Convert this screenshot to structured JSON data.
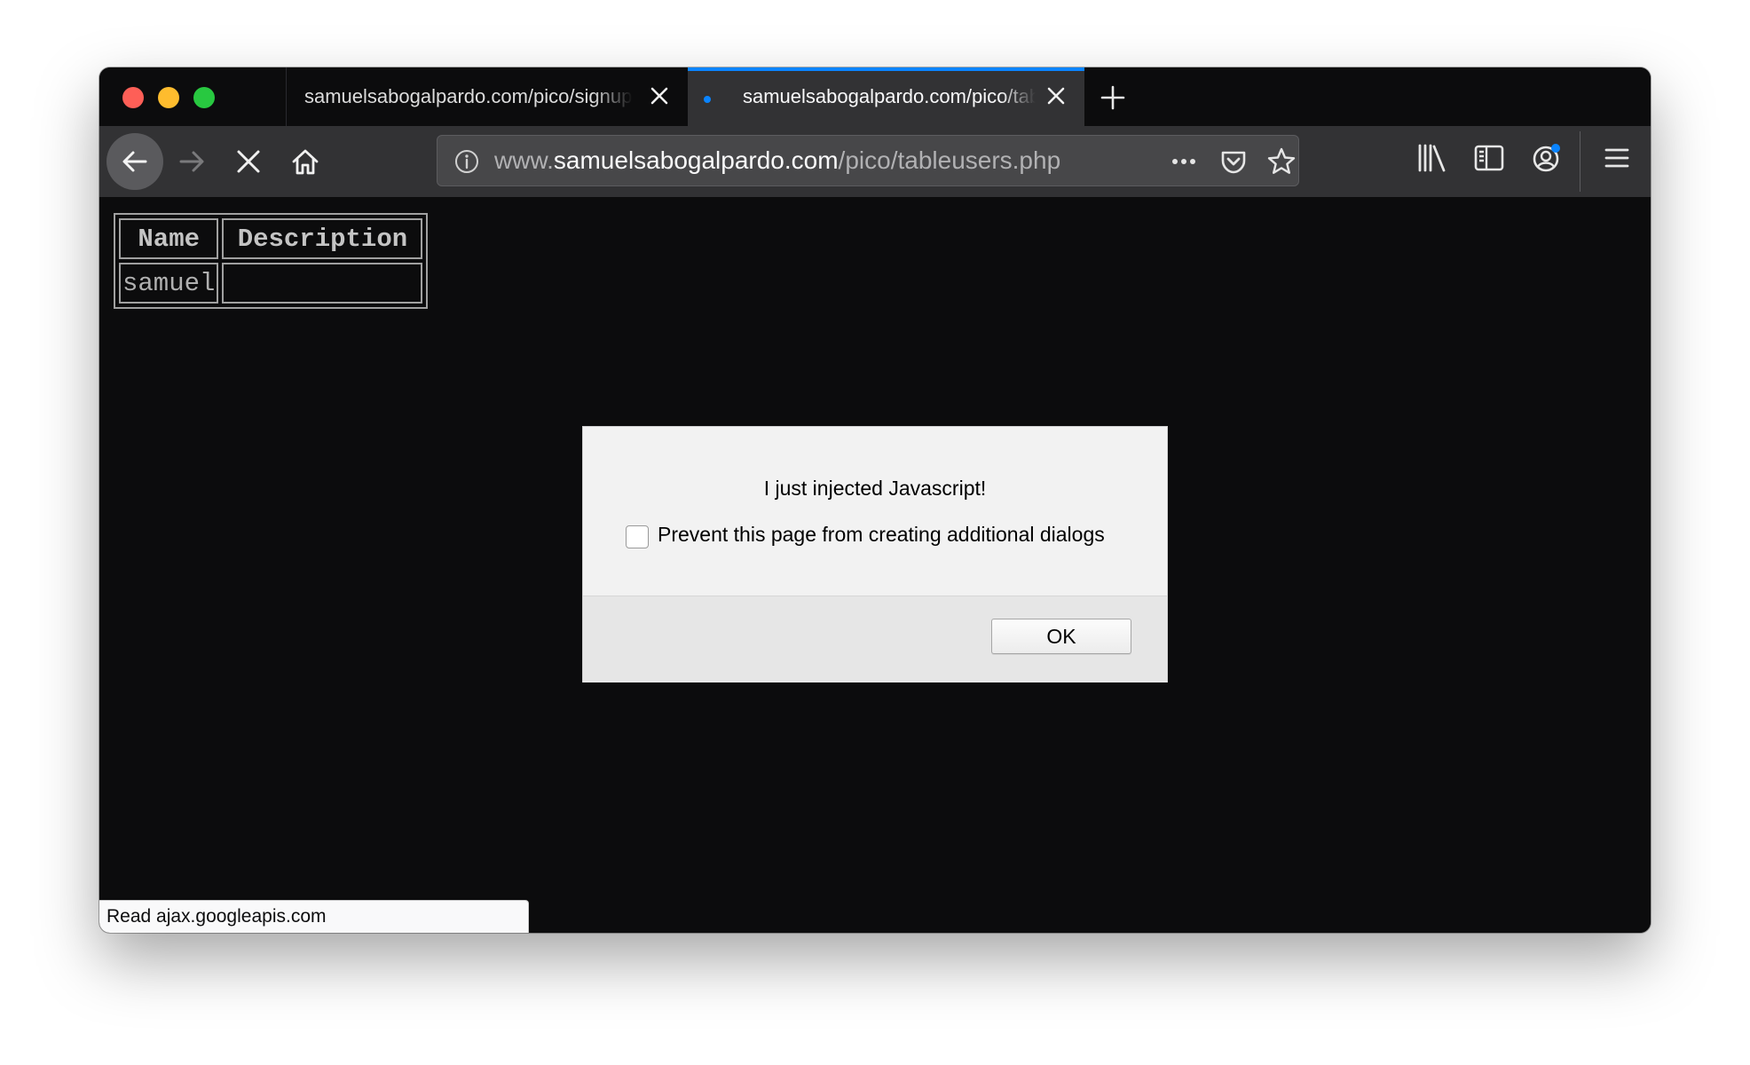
{
  "window": {
    "tabs": [
      {
        "title": "samuelsabogalpardo.com/pico/signup.php",
        "active": false,
        "loading": false
      },
      {
        "title": "samuelsabogalpardo.com/pico/tableusers.php",
        "active": true,
        "loading": true
      }
    ],
    "colors": {
      "tab_accent": "#0a84ff",
      "window_bg": "#0c0c0d",
      "toolbar_bg": "#323234"
    }
  },
  "toolbar": {
    "url_prefix": "www.",
    "url_domain": "samuelsabogalpardo.com",
    "url_path": "/pico/tableusers.php",
    "icons": [
      "back-icon",
      "forward-icon",
      "stop-icon",
      "home-icon",
      "info-icon",
      "more-actions-icon",
      "pocket-icon",
      "bookmark-star-icon",
      "library-icon",
      "sidebar-icon",
      "account-icon",
      "menu-icon"
    ]
  },
  "page": {
    "table": {
      "headers": [
        "Name",
        "Description"
      ],
      "rows": [
        [
          "samuel",
          ""
        ]
      ]
    }
  },
  "dialog": {
    "message": "I just injected Javascript!",
    "checkbox_label": "Prevent this page from creating additional dialogs",
    "checkbox_checked": false,
    "ok_label": "OK"
  },
  "status": {
    "text": "Read ajax.googleapis.com"
  }
}
